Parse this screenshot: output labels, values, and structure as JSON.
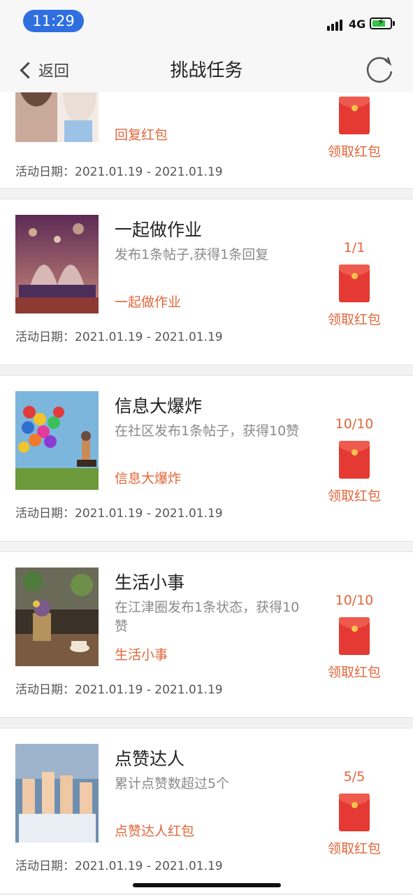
{
  "status_bar": {
    "time": "11:29",
    "network": "4G"
  },
  "nav": {
    "back_label": "返回",
    "title": "挑战任务"
  },
  "tasks": [
    {
      "title": "",
      "description": "",
      "link": "回复红包",
      "progress": "",
      "claim": "领取红包",
      "date_label": "活动日期：",
      "date_range": "2021.01.19 - 2021.01.19"
    },
    {
      "title": "一起做作业",
      "description": "发布1条帖子,获得1条回复",
      "link": "一起做作业",
      "progress": "1/1",
      "claim": "领取红包",
      "date_label": "活动日期：",
      "date_range": "2021.01.19 - 2021.01.19"
    },
    {
      "title": "信息大爆炸",
      "description": "在社区发布1条帖子，获得10赞",
      "link": "信息大爆炸",
      "progress": "10/10",
      "claim": "领取红包",
      "date_label": "活动日期：",
      "date_range": "2021.01.19 - 2021.01.19"
    },
    {
      "title": "生活小事",
      "description": "在江津圈发布1条状态，获得10赞",
      "link": "生活小事",
      "progress": "10/10",
      "claim": "领取红包",
      "date_label": "活动日期：",
      "date_range": "2021.01.19 - 2021.01.19"
    },
    {
      "title": "点赞达人",
      "description": "累计点赞数超过5个",
      "link": "点赞达人红包",
      "progress": "5/5",
      "claim": "领取红包",
      "date_label": "活动日期：",
      "date_range": "2021.01.19 - 2021.01.19"
    }
  ],
  "colors": {
    "accent": "#e2663a",
    "envelope": "#e43a33",
    "time_pill": "#2f6fe0"
  }
}
